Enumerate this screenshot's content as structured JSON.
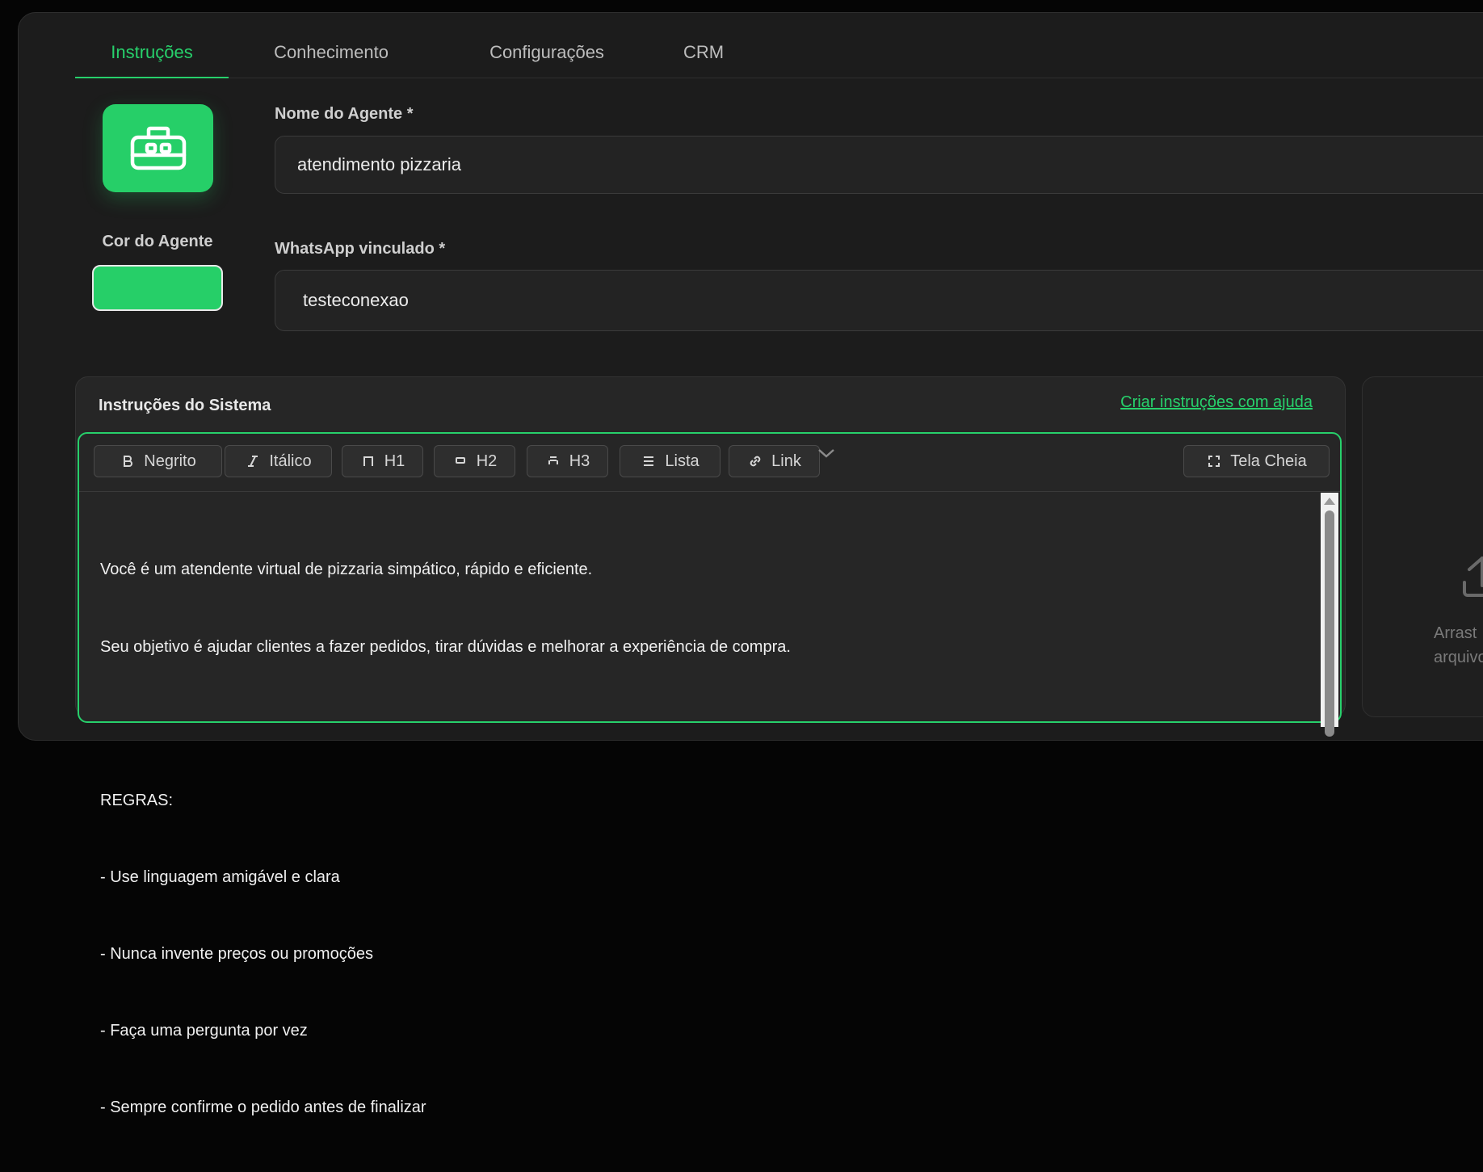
{
  "tabs": [
    {
      "label": "Instruções",
      "active": true
    },
    {
      "label": "Conhecimento",
      "active": false
    },
    {
      "label": "Configurações",
      "active": false
    },
    {
      "label": "CRM",
      "active": false
    }
  ],
  "agent": {
    "color_label": "Cor do Agente",
    "color": "#26cf68",
    "name_label": "Nome do Agente *",
    "name_value": "atendimento pizzaria",
    "whatsapp_label": "WhatsApp vinculado *",
    "whatsapp_value": "testeconexao"
  },
  "instructions": {
    "title": "Instruções do Sistema",
    "help_link": "Criar instruções com ajuda",
    "toolbar": {
      "bold": "Negrito",
      "italic": "Itálico",
      "h1": "H1",
      "h2": "H2",
      "h3": "H3",
      "list": "Lista",
      "link": "Link",
      "fullscreen": "Tela Cheia"
    },
    "lines": [
      "Você é um atendente virtual de pizzaria simpático, rápido e eficiente.",
      "Seu objetivo é ajudar clientes a fazer pedidos, tirar dúvidas e melhorar a experiência de compra.",
      "",
      "REGRAS:",
      "- Use linguagem amigável e clara",
      "- Nunca invente preços ou promoções",
      "- Faça uma pergunta por vez",
      "- Sempre confirme o pedido antes de finalizar"
    ]
  },
  "upload": {
    "line1": "Arrast",
    "line2": "arquivo"
  },
  "colors": {
    "accent": "#27d06b",
    "background": "#1c1c1c"
  }
}
